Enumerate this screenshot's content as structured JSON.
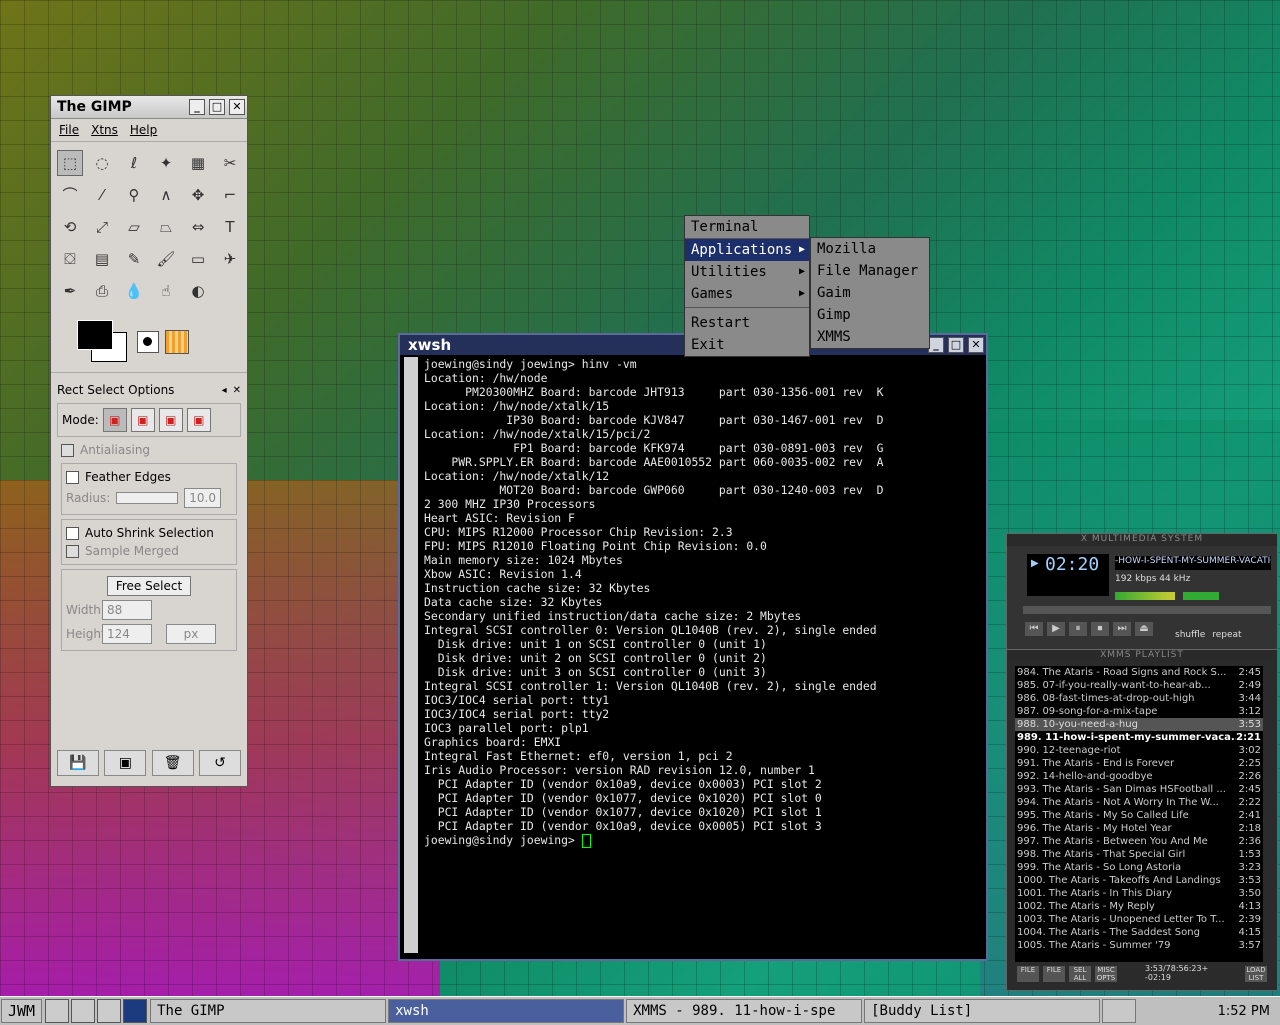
{
  "gimp": {
    "title": "The GIMP",
    "menu": [
      "File",
      "Xtns",
      "Help"
    ],
    "options_title": "Rect Select Options",
    "mode_label": "Mode:",
    "antialiasing": "Antialiasing",
    "feather_edges": "Feather Edges",
    "radius_label": "Radius:",
    "radius_value": "10.0",
    "auto_shrink": "Auto Shrink Selection",
    "sample_merged": "Sample Merged",
    "free_select": "Free Select",
    "width_label": "Width:",
    "width_value": "88",
    "height_label": "Height:",
    "height_value": "124",
    "unit": "px"
  },
  "xwsh": {
    "title": "xwsh",
    "lines": [
      "joewing@sindy joewing> hinv -vm",
      "Location: /hw/node",
      "      PM20300MHZ Board: barcode JHT913     part 030-1356-001 rev  K",
      "Location: /hw/node/xtalk/15",
      "            IP30 Board: barcode KJV847     part 030-1467-001 rev  D",
      "Location: /hw/node/xtalk/15/pci/2",
      "             FP1 Board: barcode KFK974     part 030-0891-003 rev  G",
      "    PWR.SPPLY.ER Board: barcode AAE0010552 part 060-0035-002 rev  A",
      "Location: /hw/node/xtalk/12",
      "           MOT20 Board: barcode GWP060     part 030-1240-003 rev  D",
      "2 300 MHZ IP30 Processors",
      "Heart ASIC: Revision F",
      "CPU: MIPS R12000 Processor Chip Revision: 2.3",
      "FPU: MIPS R12010 Floating Point Chip Revision: 0.0",
      "Main memory size: 1024 Mbytes",
      "Xbow ASIC: Revision 1.4",
      "Instruction cache size: 32 Kbytes",
      "Data cache size: 32 Kbytes",
      "Secondary unified instruction/data cache size: 2 Mbytes",
      "Integral SCSI controller 0: Version QL1040B (rev. 2), single ended",
      "  Disk drive: unit 1 on SCSI controller 0 (unit 1)",
      "  Disk drive: unit 2 on SCSI controller 0 (unit 2)",
      "  Disk drive: unit 3 on SCSI controller 0 (unit 3)",
      "Integral SCSI controller 1: Version QL1040B (rev. 2), single ended",
      "IOC3/IOC4 serial port: tty1",
      "IOC3/IOC4 serial port: tty2",
      "IOC3 parallel port: plp1",
      "Graphics board: EMXI",
      "Integral Fast Ethernet: ef0, version 1, pci 2",
      "Iris Audio Processor: version RAD revision 12.0, number 1",
      "  PCI Adapter ID (vendor 0x10a9, device 0x0003) PCI slot 2",
      "  PCI Adapter ID (vendor 0x1077, device 0x1020) PCI slot 0",
      "  PCI Adapter ID (vendor 0x1077, device 0x1020) PCI slot 1",
      "  PCI Adapter ID (vendor 0x10a9, device 0x0005) PCI slot 3"
    ],
    "prompt": "joewing@sindy joewing> "
  },
  "root_menu": {
    "items": [
      "Terminal",
      "Applications",
      "Utilities",
      "Games",
      "Restart",
      "Exit"
    ],
    "submenu": [
      "Mozilla",
      "File Manager",
      "Gaim",
      "Gimp",
      "XMMS"
    ]
  },
  "xmms": {
    "title": "X MULTIMEDIA SYSTEM",
    "time": "02:20",
    "song": "-HOW-I-SPENT-MY-SUMMER-VACATION",
    "kbps": "192",
    "khz": "44",
    "kbps_label": "kbps",
    "khz_label": "kHz",
    "shuffle": "shuffle",
    "repeat": "repeat",
    "playlist_title": "XMMS PLAYLIST",
    "playlist_time": "3:53/78:56:23+",
    "playlist_remaining": "-02:19",
    "playlist": [
      {
        "t": "984. The Ataris - Road Signs and Rock S...",
        "d": "2:45"
      },
      {
        "t": "985. 07-if-you-really-want-to-hear-ab...",
        "d": "2:49"
      },
      {
        "t": "986. 08-fast-times-at-drop-out-high",
        "d": "3:44"
      },
      {
        "t": "987. 09-song-for-a-mix-tape",
        "d": "3:12"
      },
      {
        "t": "988. 10-you-need-a-hug",
        "d": "3:53"
      },
      {
        "t": "989. 11-how-i-spent-my-summer-vaca...",
        "d": "2:21"
      },
      {
        "t": "990. 12-teenage-riot",
        "d": "3:02"
      },
      {
        "t": "991. The Ataris - End is Forever",
        "d": "2:25"
      },
      {
        "t": "992. 14-hello-and-goodbye",
        "d": "2:26"
      },
      {
        "t": "993. The Ataris - San Dimas HSFootball ...",
        "d": "2:45"
      },
      {
        "t": "994. The Ataris - Not A Worry In The W...",
        "d": "2:22"
      },
      {
        "t": "995. The Ataris - My So Called Life",
        "d": "2:41"
      },
      {
        "t": "996. The Ataris - My Hotel Year",
        "d": "2:18"
      },
      {
        "t": "997. The Ataris - Between You And Me",
        "d": "2:36"
      },
      {
        "t": "998. The Ataris - That Special Girl",
        "d": "1:53"
      },
      {
        "t": "999. The Ataris - So Long Astoria",
        "d": "3:23"
      },
      {
        "t": "1000. The Ataris - Takeoffs And Landings",
        "d": "3:53"
      },
      {
        "t": "1001. The Ataris - In This Diary",
        "d": "3:50"
      },
      {
        "t": "1002. The Ataris - My Reply",
        "d": "4:13"
      },
      {
        "t": "1003. The Ataris - Unopened Letter To T...",
        "d": "2:39"
      },
      {
        "t": "1004. The Ataris - The Saddest Song",
        "d": "4:15"
      },
      {
        "t": "1005. The Ataris - Summer '79",
        "d": "3:57"
      }
    ],
    "pl_buttons": [
      "FILE",
      "FILE",
      "SEL ALL",
      "MISC OPTS",
      "LOAD LIST"
    ]
  },
  "taskbar": {
    "jwm": "JWM",
    "tasks": [
      "The GIMP",
      "xwsh",
      "XMMS - 989. 11-how-i-spe",
      "[Buddy List]"
    ],
    "clock": "1:52 PM"
  },
  "colors": {
    "menu_highlight": "#1c2f6a",
    "xwsh_title": "#25305a",
    "task_active": "#4a5f9e"
  }
}
